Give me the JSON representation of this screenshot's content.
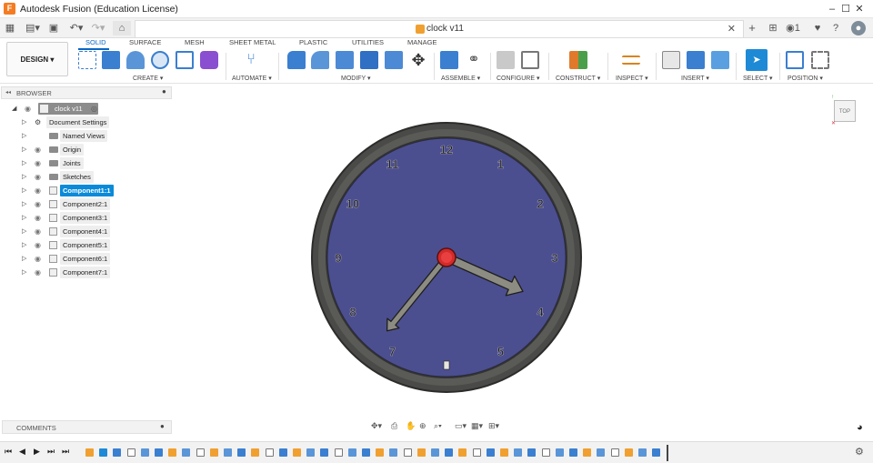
{
  "app": {
    "title": "Autodesk Fusion (Education License)",
    "logo_letter": "F"
  },
  "window_controls": {
    "minimize": "–",
    "maximize": "☐",
    "close": "✕"
  },
  "document": {
    "tab_name": "clock v11",
    "close": "✕",
    "add": "+",
    "job_count": "1"
  },
  "workspace": {
    "label": "DESIGN ▾"
  },
  "tabs": [
    "SOLID",
    "SURFACE",
    "MESH",
    "SHEET METAL",
    "PLASTIC",
    "UTILITIES",
    "MANAGE"
  ],
  "groups": [
    "CREATE ▾",
    "AUTOMATE ▾",
    "MODIFY ▾",
    "ASSEMBLE ▾",
    "CONFIGURE ▾",
    "CONSTRUCT ▾",
    "INSPECT ▾",
    "INSERT ▾",
    "SELECT ▾",
    "POSITION ▾"
  ],
  "browser": {
    "header": "BROWSER",
    "collapse": "◂◂",
    "root": "clock v11",
    "items": [
      {
        "label": "Document Settings",
        "icon": "gear-icon",
        "visible_toggle": false,
        "selected": false
      },
      {
        "label": "Named Views",
        "icon": "folder-icon",
        "visible_toggle": false,
        "selected": false
      },
      {
        "label": "Origin",
        "icon": "folder-icon",
        "visible_toggle": true,
        "selected": false
      },
      {
        "label": "Joints",
        "icon": "folder-icon",
        "visible_toggle": true,
        "selected": false
      },
      {
        "label": "Sketches",
        "icon": "folder-icon",
        "visible_toggle": true,
        "selected": false
      },
      {
        "label": "Component1:1",
        "icon": "component-icon",
        "visible_toggle": true,
        "selected": true
      },
      {
        "label": "Component2:1",
        "icon": "component-icon",
        "visible_toggle": true,
        "selected": false
      },
      {
        "label": "Component3:1",
        "icon": "component-icon",
        "visible_toggle": true,
        "selected": false
      },
      {
        "label": "Component4:1",
        "icon": "component-icon",
        "visible_toggle": true,
        "selected": false
      },
      {
        "label": "Component5:1",
        "icon": "component-icon",
        "visible_toggle": true,
        "selected": false
      },
      {
        "label": "Component6:1",
        "icon": "component-icon",
        "visible_toggle": true,
        "selected": false
      },
      {
        "label": "Component7:1",
        "icon": "component-icon",
        "visible_toggle": true,
        "selected": false
      }
    ]
  },
  "viewcube": {
    "face": "TOP"
  },
  "clock": {
    "numerals": [
      "12",
      "1",
      "2",
      "3",
      "4",
      "5",
      "",
      "7",
      "8",
      "9",
      "10",
      "11"
    ],
    "hour_value": 3.8,
    "minute_value": 36.5
  },
  "comments": {
    "label": "COMMENTS"
  },
  "colors": {
    "accent": "#0a66c2",
    "selection": "#0a8ad9",
    "dial": "#4b4f8f",
    "rim": "#4a4a48",
    "hands": "#8d8c83",
    "hub": "#d42a2a"
  }
}
